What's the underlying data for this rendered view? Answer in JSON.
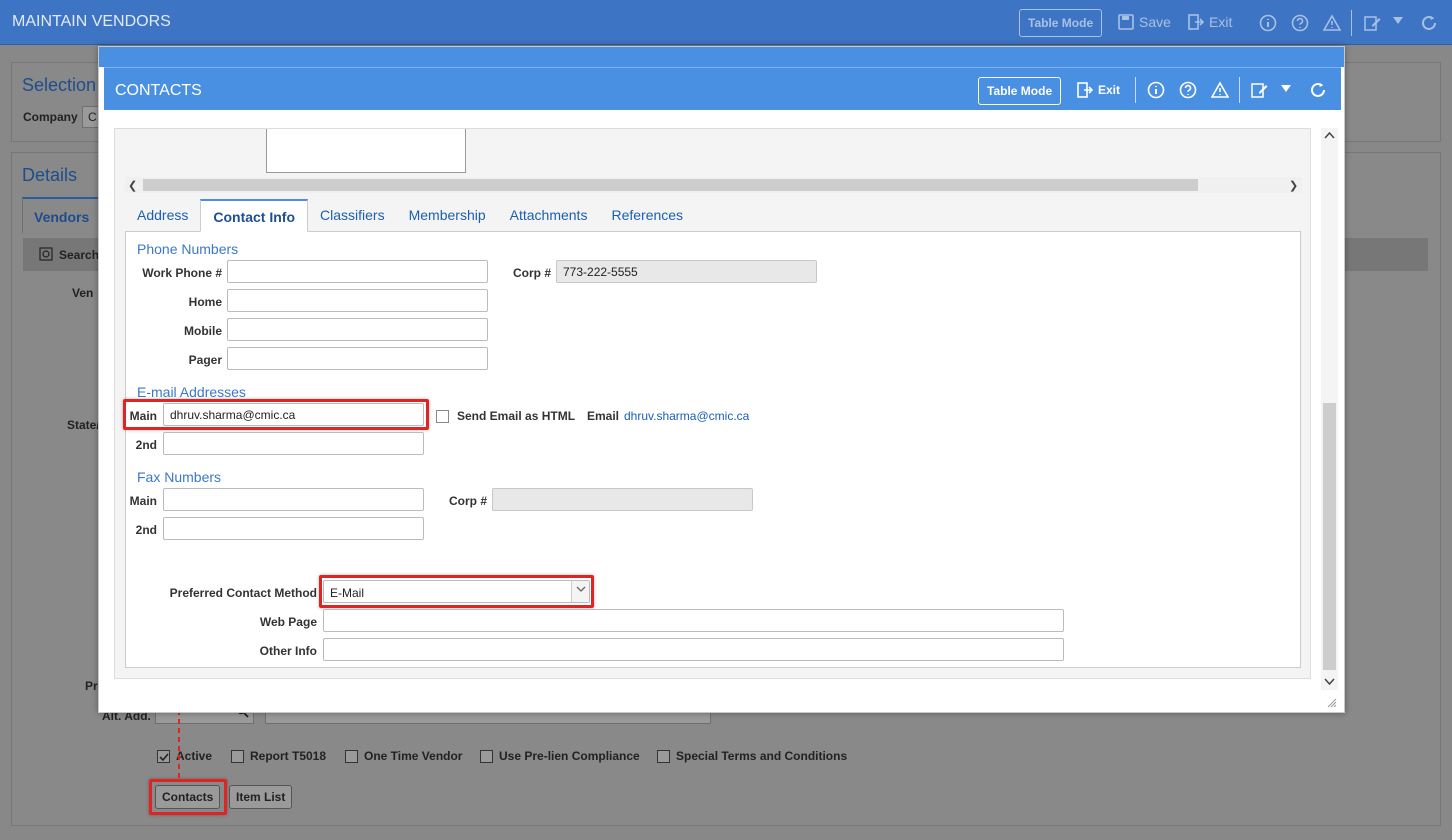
{
  "main": {
    "title": "MAINTAIN VENDORS",
    "table_mode": "Table Mode",
    "save": "Save",
    "exit": "Exit",
    "selection_title": "Selection",
    "company_label": "Company",
    "company_value": "C",
    "details_title": "Details",
    "vendors_tab": "Vendors",
    "search_label": "Search",
    "partial_labels": [
      "Ven",
      "State/",
      "Pr",
      "Alt. Add."
    ],
    "checkboxes": [
      {
        "label": "Active",
        "checked": true
      },
      {
        "label": "Report T5018",
        "checked": false
      },
      {
        "label": "One Time Vendor",
        "checked": false
      },
      {
        "label": "Use Pre-lien Compliance",
        "checked": false
      },
      {
        "label": "Special Terms and Conditions",
        "checked": false
      }
    ],
    "contacts_button": "Contacts",
    "item_list_button": "Item List"
  },
  "dialog": {
    "title": "CONTACTS",
    "table_mode": "Table Mode",
    "exit": "Exit",
    "tabs": [
      "Address",
      "Contact Info",
      "Classifiers",
      "Membership",
      "Attachments",
      "References"
    ],
    "active_tab": "Contact Info",
    "phone": {
      "section": "Phone Numbers",
      "work_label": "Work Phone #",
      "work_value": "",
      "home_label": "Home",
      "home_value": "",
      "mobile_label": "Mobile",
      "mobile_value": "",
      "pager_label": "Pager",
      "pager_value": "",
      "corp_label": "Corp #",
      "corp_value": "773-222-5555"
    },
    "email": {
      "section": "E-mail Addresses",
      "main_label": "Main",
      "main_value": "dhruv.sharma@cmic.ca",
      "second_label": "2nd",
      "second_value": "",
      "send_html_label": "Send Email as HTML",
      "email_label": "Email",
      "email_link": "dhruv.sharma@cmic.ca"
    },
    "fax": {
      "section": "Fax Numbers",
      "main_label": "Main",
      "main_value": "",
      "second_label": "2nd",
      "second_value": "",
      "corp_label": "Corp #",
      "corp_value": ""
    },
    "preferred_label": "Preferred Contact Method",
    "preferred_value": "E-Mail",
    "web_label": "Web Page",
    "web_value": "",
    "other_label": "Other Info",
    "other_value": ""
  }
}
